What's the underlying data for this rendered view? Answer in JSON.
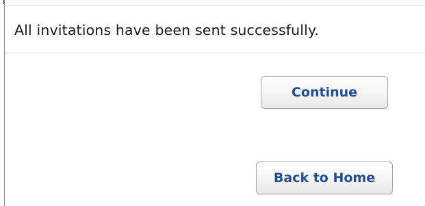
{
  "message": {
    "text": "All invitations have been sent successfully."
  },
  "actions": {
    "continue_label": "Continue",
    "back_home_label": "Back to Home"
  },
  "colors": {
    "button_text": "#1f4e96",
    "message_text": "#1a1a1a",
    "border": "#d4d4d4"
  }
}
